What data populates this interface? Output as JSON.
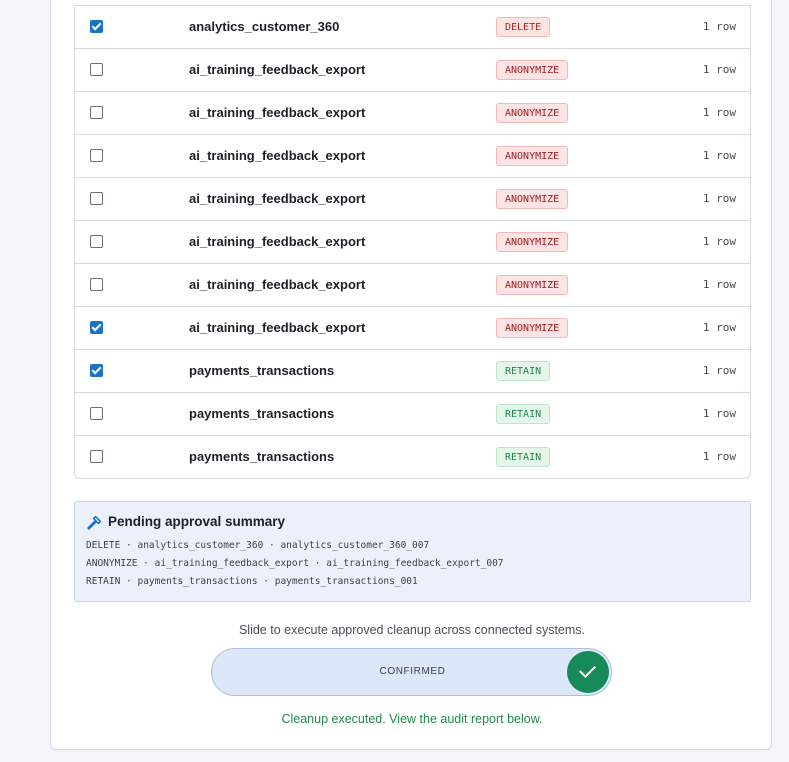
{
  "rows": [
    {
      "checked": true,
      "name": "analytics_customer_360",
      "action": "DELETE",
      "kind": "delete",
      "count": "1 row"
    },
    {
      "checked": false,
      "name": "ai_training_feedback_export",
      "action": "ANONYMIZE",
      "kind": "anon",
      "count": "1 row"
    },
    {
      "checked": false,
      "name": "ai_training_feedback_export",
      "action": "ANONYMIZE",
      "kind": "anon",
      "count": "1 row"
    },
    {
      "checked": false,
      "name": "ai_training_feedback_export",
      "action": "ANONYMIZE",
      "kind": "anon",
      "count": "1 row"
    },
    {
      "checked": false,
      "name": "ai_training_feedback_export",
      "action": "ANONYMIZE",
      "kind": "anon",
      "count": "1 row"
    },
    {
      "checked": false,
      "name": "ai_training_feedback_export",
      "action": "ANONYMIZE",
      "kind": "anon",
      "count": "1 row"
    },
    {
      "checked": false,
      "name": "ai_training_feedback_export",
      "action": "ANONYMIZE",
      "kind": "anon",
      "count": "1 row"
    },
    {
      "checked": true,
      "name": "ai_training_feedback_export",
      "action": "ANONYMIZE",
      "kind": "anon",
      "count": "1 row"
    },
    {
      "checked": true,
      "name": "payments_transactions",
      "action": "RETAIN",
      "kind": "retain",
      "count": "1 row"
    },
    {
      "checked": false,
      "name": "payments_transactions",
      "action": "RETAIN",
      "kind": "retain",
      "count": "1 row"
    },
    {
      "checked": false,
      "name": "payments_transactions",
      "action": "RETAIN",
      "kind": "retain",
      "count": "1 row"
    }
  ],
  "summary": {
    "title": "Pending approval summary",
    "icon": "hammer-icon",
    "lines": [
      "DELETE · analytics_customer_360 · analytics_customer_360_007",
      "ANONYMIZE · ai_training_feedback_export · ai_training_feedback_export_007",
      "RETAIN · payments_transactions · payments_transactions_001"
    ]
  },
  "execute": {
    "hint": "Slide to execute approved cleanup across connected systems.",
    "slider_label": "CONFIRMED",
    "slider_progress": 1.0,
    "done_message": "Cleanup executed. View the audit report below."
  },
  "colors": {
    "accent_blue": "#1a73c9",
    "success_green": "#178a5a",
    "danger_red": "#b3261e"
  }
}
